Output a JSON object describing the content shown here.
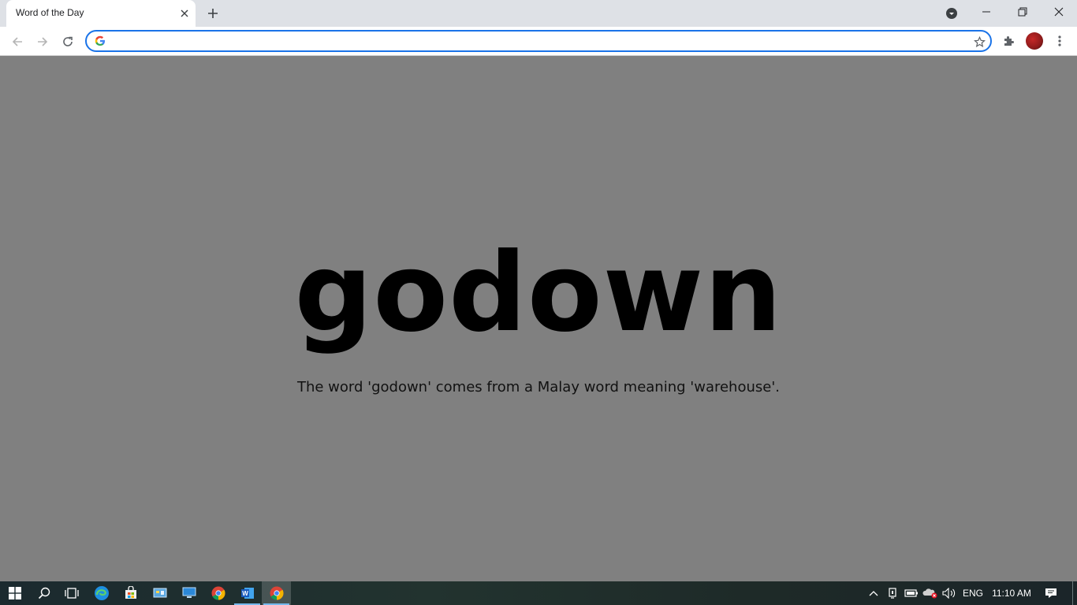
{
  "browser": {
    "tab_title": "Word of the Day",
    "address_value": "",
    "address_placeholder": ""
  },
  "page": {
    "word": "godown",
    "meaning": "The word 'godown' comes from a Malay word meaning 'warehouse'."
  },
  "taskbar": {
    "language": "ENG",
    "time": "11:10 AM"
  },
  "colors": {
    "page_background": "#808080",
    "accent": "#1a73e8"
  }
}
